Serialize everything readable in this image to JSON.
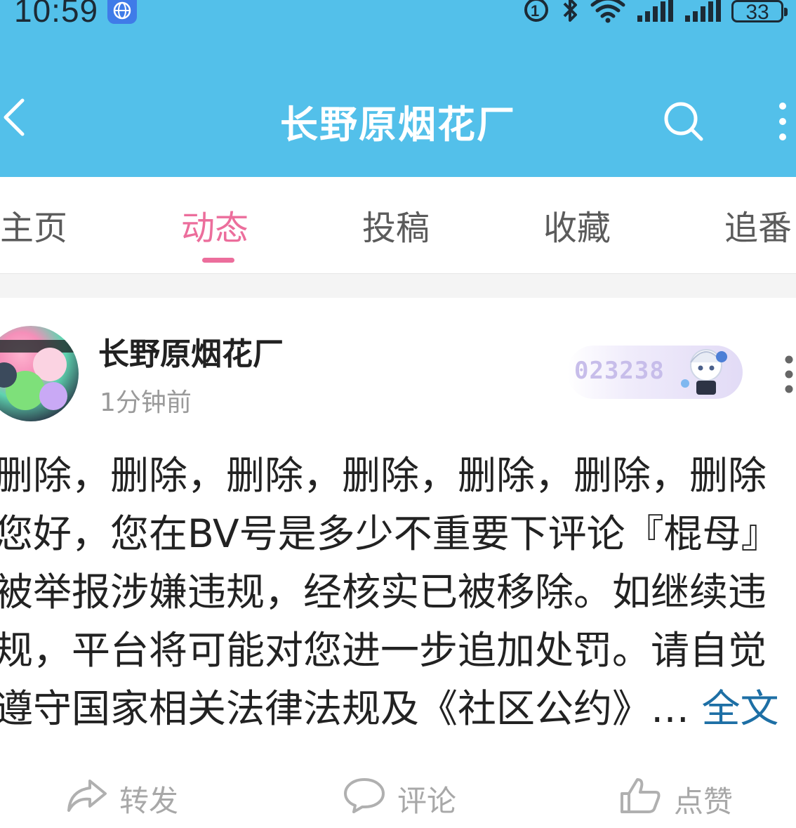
{
  "status_bar": {
    "time": "10:59",
    "battery": "33",
    "icons": [
      "globe-icon",
      "sim-card-icon",
      "bluetooth-icon",
      "wifi-icon",
      "cellular-signal-icon",
      "cellular-signal-icon",
      "battery-icon"
    ]
  },
  "nav": {
    "title": "长野原烟花厂",
    "icons": [
      "back-arrow-icon",
      "search-icon",
      "more-vertical-icon"
    ]
  },
  "tabs": [
    {
      "label": "主页",
      "active": false
    },
    {
      "label": "动态",
      "active": true
    },
    {
      "label": "投稿",
      "active": false
    },
    {
      "label": "收藏",
      "active": false
    },
    {
      "label": "追番",
      "active": false
    }
  ],
  "post": {
    "author": "长野原烟花厂",
    "time": "1分钟前",
    "fan_badge_number": "023238",
    "lines": [
      "删除，删除，删除，删除，删除，删除，删除",
      "您好，您在BV号是多少不重要下评论『棍母』",
      "被举报涉嫌违规，经核实已被移除。如继续违",
      "规，平台将可能对您进一步追加处罚。请自觉",
      "遵守国家相关法律法规及《社区公约》…"
    ],
    "full_text_link": "全文",
    "actions": [
      {
        "label": "转发",
        "icon": "share-icon"
      },
      {
        "label": "评论",
        "icon": "comment-icon"
      },
      {
        "label": "点赞",
        "icon": "thumbs-up-icon"
      }
    ]
  },
  "colors": {
    "header": "#53c0ea",
    "accent": "#ec6e9c",
    "link": "#1d6fa5"
  }
}
